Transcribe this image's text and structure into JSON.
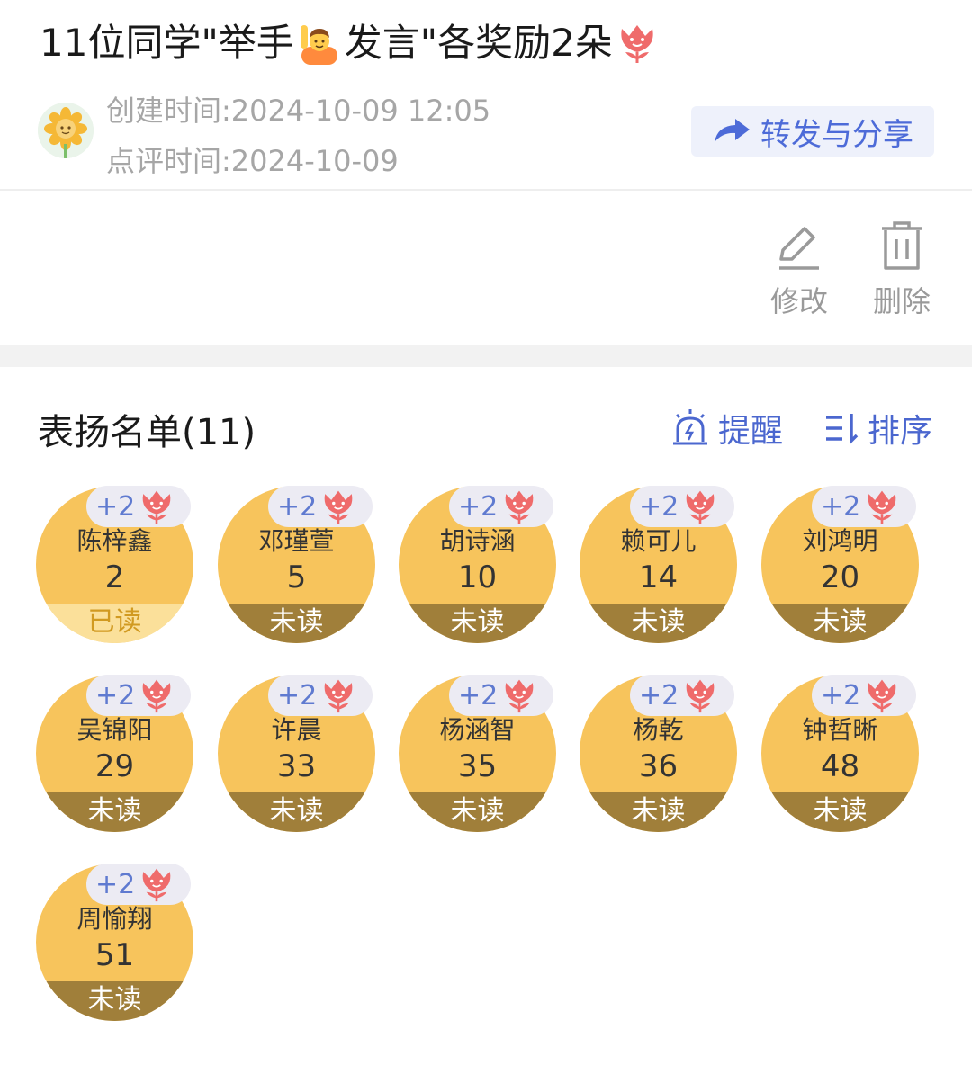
{
  "header": {
    "title_before_emoji": "11位同学\"举手",
    "title_after_emoji": "发言\"各奖励2朵",
    "created_label": "创建时间:2024-10-09 12:05",
    "reviewed_label": "点评时间:2024-10-09",
    "share_label": "转发与分享"
  },
  "actions": {
    "edit_label": "修改",
    "delete_label": "删除"
  },
  "praise": {
    "title": "表扬名单(11)",
    "remind_label": "提醒",
    "sort_label": "排序"
  },
  "students": [
    {
      "name": "陈梓鑫",
      "number": "2",
      "points": "+2",
      "status": "已读"
    },
    {
      "name": "邓瑾萱",
      "number": "5",
      "points": "+2",
      "status": "未读"
    },
    {
      "name": "胡诗涵",
      "number": "10",
      "points": "+2",
      "status": "未读"
    },
    {
      "name": "赖可儿",
      "number": "14",
      "points": "+2",
      "status": "未读"
    },
    {
      "name": "刘鸿明",
      "number": "20",
      "points": "+2",
      "status": "未读"
    },
    {
      "name": "吴锦阳",
      "number": "29",
      "points": "+2",
      "status": "未读"
    },
    {
      "name": "许晨",
      "number": "33",
      "points": "+2",
      "status": "未读"
    },
    {
      "name": "杨涵智",
      "number": "35",
      "points": "+2",
      "status": "未读"
    },
    {
      "name": "杨乾",
      "number": "36",
      "points": "+2",
      "status": "未读"
    },
    {
      "name": "钟哲晰",
      "number": "48",
      "points": "+2",
      "status": "未读"
    },
    {
      "name": "周愉翔",
      "number": "51",
      "points": "+2",
      "status": "未读"
    }
  ],
  "colors": {
    "accent": "#4b67cf",
    "circle": "#f7c45c",
    "unread_band": "#a07f3a",
    "read_band": "#fbe09a",
    "flower": "#ef6b6b"
  },
  "icons": {
    "title_emoji": "person-raising-hand-icon",
    "title_flower": "tulip-flower-icon",
    "avatar": "sunflower-avatar-icon",
    "share": "share-arrow-icon",
    "edit": "pencil-edit-icon",
    "delete": "trash-icon",
    "remind": "alarm-bell-icon",
    "sort": "sort-icon",
    "badge_flower": "tulip-flower-icon"
  }
}
